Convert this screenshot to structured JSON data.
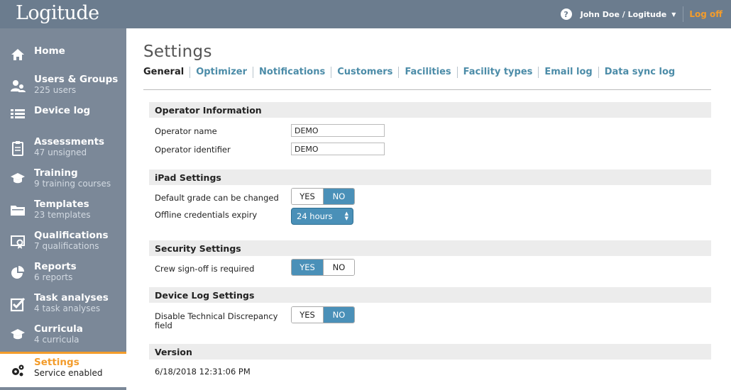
{
  "header": {
    "logo": "Logitude",
    "help": "?",
    "user": "John Doe / Logitude",
    "logoff": "Log off"
  },
  "sidebar": {
    "items": [
      {
        "title": "Home",
        "sub": "",
        "icon": "home-icon"
      },
      {
        "title": "Users & Groups",
        "sub": "225 users",
        "icon": "users-icon"
      },
      {
        "title": "Device log",
        "sub": "",
        "icon": "list-icon"
      },
      {
        "title": "Assessments",
        "sub": "47 unsigned",
        "icon": "clipboard-icon"
      },
      {
        "title": "Training",
        "sub": "9 training courses",
        "icon": "graduation-cap-icon"
      },
      {
        "title": "Templates",
        "sub": "23 templates",
        "icon": "folder-icon"
      },
      {
        "title": "Qualifications",
        "sub": "7 qualifications",
        "icon": "certificate-icon"
      },
      {
        "title": "Reports",
        "sub": "6 reports",
        "icon": "pie-chart-icon"
      },
      {
        "title": "Task analyses",
        "sub": "4 task analyses",
        "icon": "checkbox-icon"
      },
      {
        "title": "Curricula",
        "sub": "4 curricula",
        "icon": "graduation-cap-icon"
      },
      {
        "title": "Settings",
        "sub": "Service enabled",
        "icon": "gears-icon"
      }
    ]
  },
  "main": {
    "title": "Settings",
    "tabs": [
      "General",
      "Optimizer",
      "Notifications",
      "Customers",
      "Facilities",
      "Facility types",
      "Email log",
      "Data sync log"
    ],
    "operator": {
      "heading": "Operator Information",
      "name_label": "Operator name",
      "name_value": "DEMO",
      "id_label": "Operator identifier",
      "id_value": "DEMO"
    },
    "ipad": {
      "heading": "iPad Settings",
      "grade_label": "Default grade can be changed",
      "expiry_label": "Offline credentials expiry",
      "expiry_value": "24 hours"
    },
    "security": {
      "heading": "Security Settings",
      "crew_label": "Crew sign-off is required"
    },
    "devicelog": {
      "heading": "Device Log Settings",
      "disable_label_1": "Disable Technical Discrepancy",
      "disable_label_2": "field"
    },
    "version": {
      "heading": "Version",
      "value": "6/18/2018 12:31:06 PM"
    },
    "toggle": {
      "yes": "YES",
      "no": "NO"
    }
  },
  "colors": {
    "header": "#6b7c8e",
    "sidebar": "#7b8898",
    "accent": "#f39c2b",
    "toggle_on": "#4a90b8",
    "link": "#4c8ca8"
  }
}
